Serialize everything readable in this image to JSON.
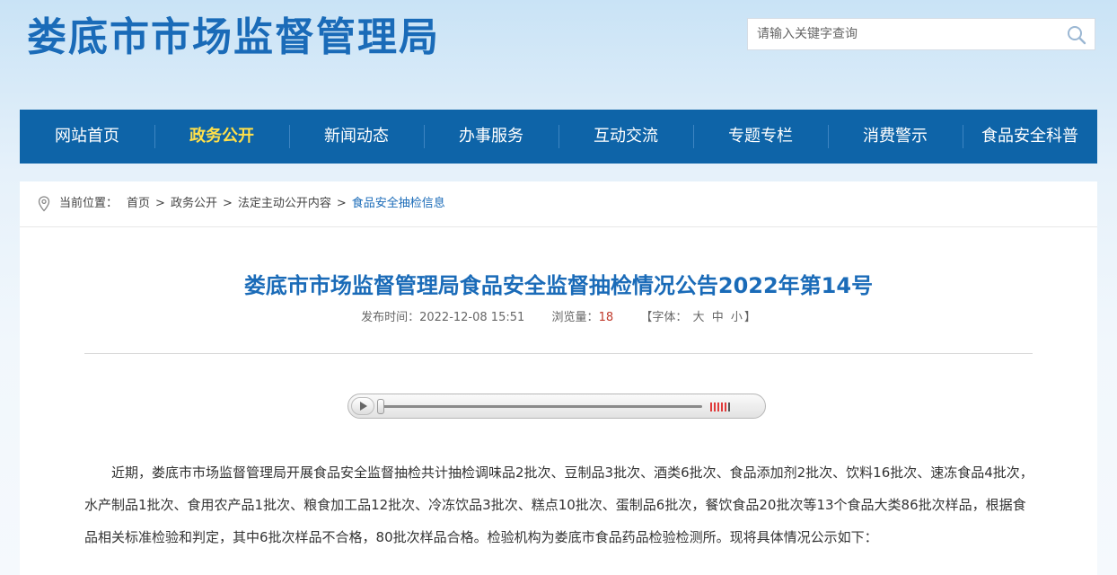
{
  "site": {
    "title": "娄底市市场监督管理局"
  },
  "search": {
    "placeholder": "请输入关键字查询"
  },
  "nav": {
    "items": [
      {
        "label": "网站首页",
        "active": false
      },
      {
        "label": "政务公开",
        "active": true
      },
      {
        "label": "新闻动态",
        "active": false
      },
      {
        "label": "办事服务",
        "active": false
      },
      {
        "label": "互动交流",
        "active": false
      },
      {
        "label": "专题专栏",
        "active": false
      },
      {
        "label": "消费警示",
        "active": false
      },
      {
        "label": "食品安全科普",
        "active": false
      }
    ]
  },
  "breadcrumb": {
    "label": "当前位置：",
    "items": [
      "首页",
      "政务公开",
      "法定主动公开内容"
    ],
    "separator": ">",
    "current": "食品安全抽检信息"
  },
  "article": {
    "title": "娄底市市场监督管理局食品安全监督抽检情况公告2022年第14号",
    "publish_label": "发布时间：",
    "publish_time": "2022-12-08 15:51",
    "views_label": "浏览量：",
    "views": "18",
    "font_open": "【字体：",
    "font_large": "大",
    "font_medium": "中",
    "font_small": "小",
    "font_close": "】",
    "body": "近期，娄底市市场监督管理局开展食品安全监督抽检共计抽检调味品2批次、豆制品3批次、酒类6批次、食品添加剂2批次、饮料16批次、速冻食品4批次，水产制品1批次、食用农产品1批次、粮食加工品12批次、冷冻饮品3批次、糕点10批次、蛋制品6批次，餐饮食品20批次等13个食品大类86批次样品，根据食品相关标准检验和判定，其中6批次样品不合格，80批次样品合格。检验机构为娄底市食品药品检验检测所。现将具体情况公示如下："
  },
  "audio_player": {
    "progress": 0,
    "volume_icon": "volume-bars-icon"
  },
  "colors": {
    "brand": "#1a6bb8",
    "nav_bg": "#0e64a8",
    "nav_active": "#ffe04a",
    "views": "#c0392b"
  }
}
